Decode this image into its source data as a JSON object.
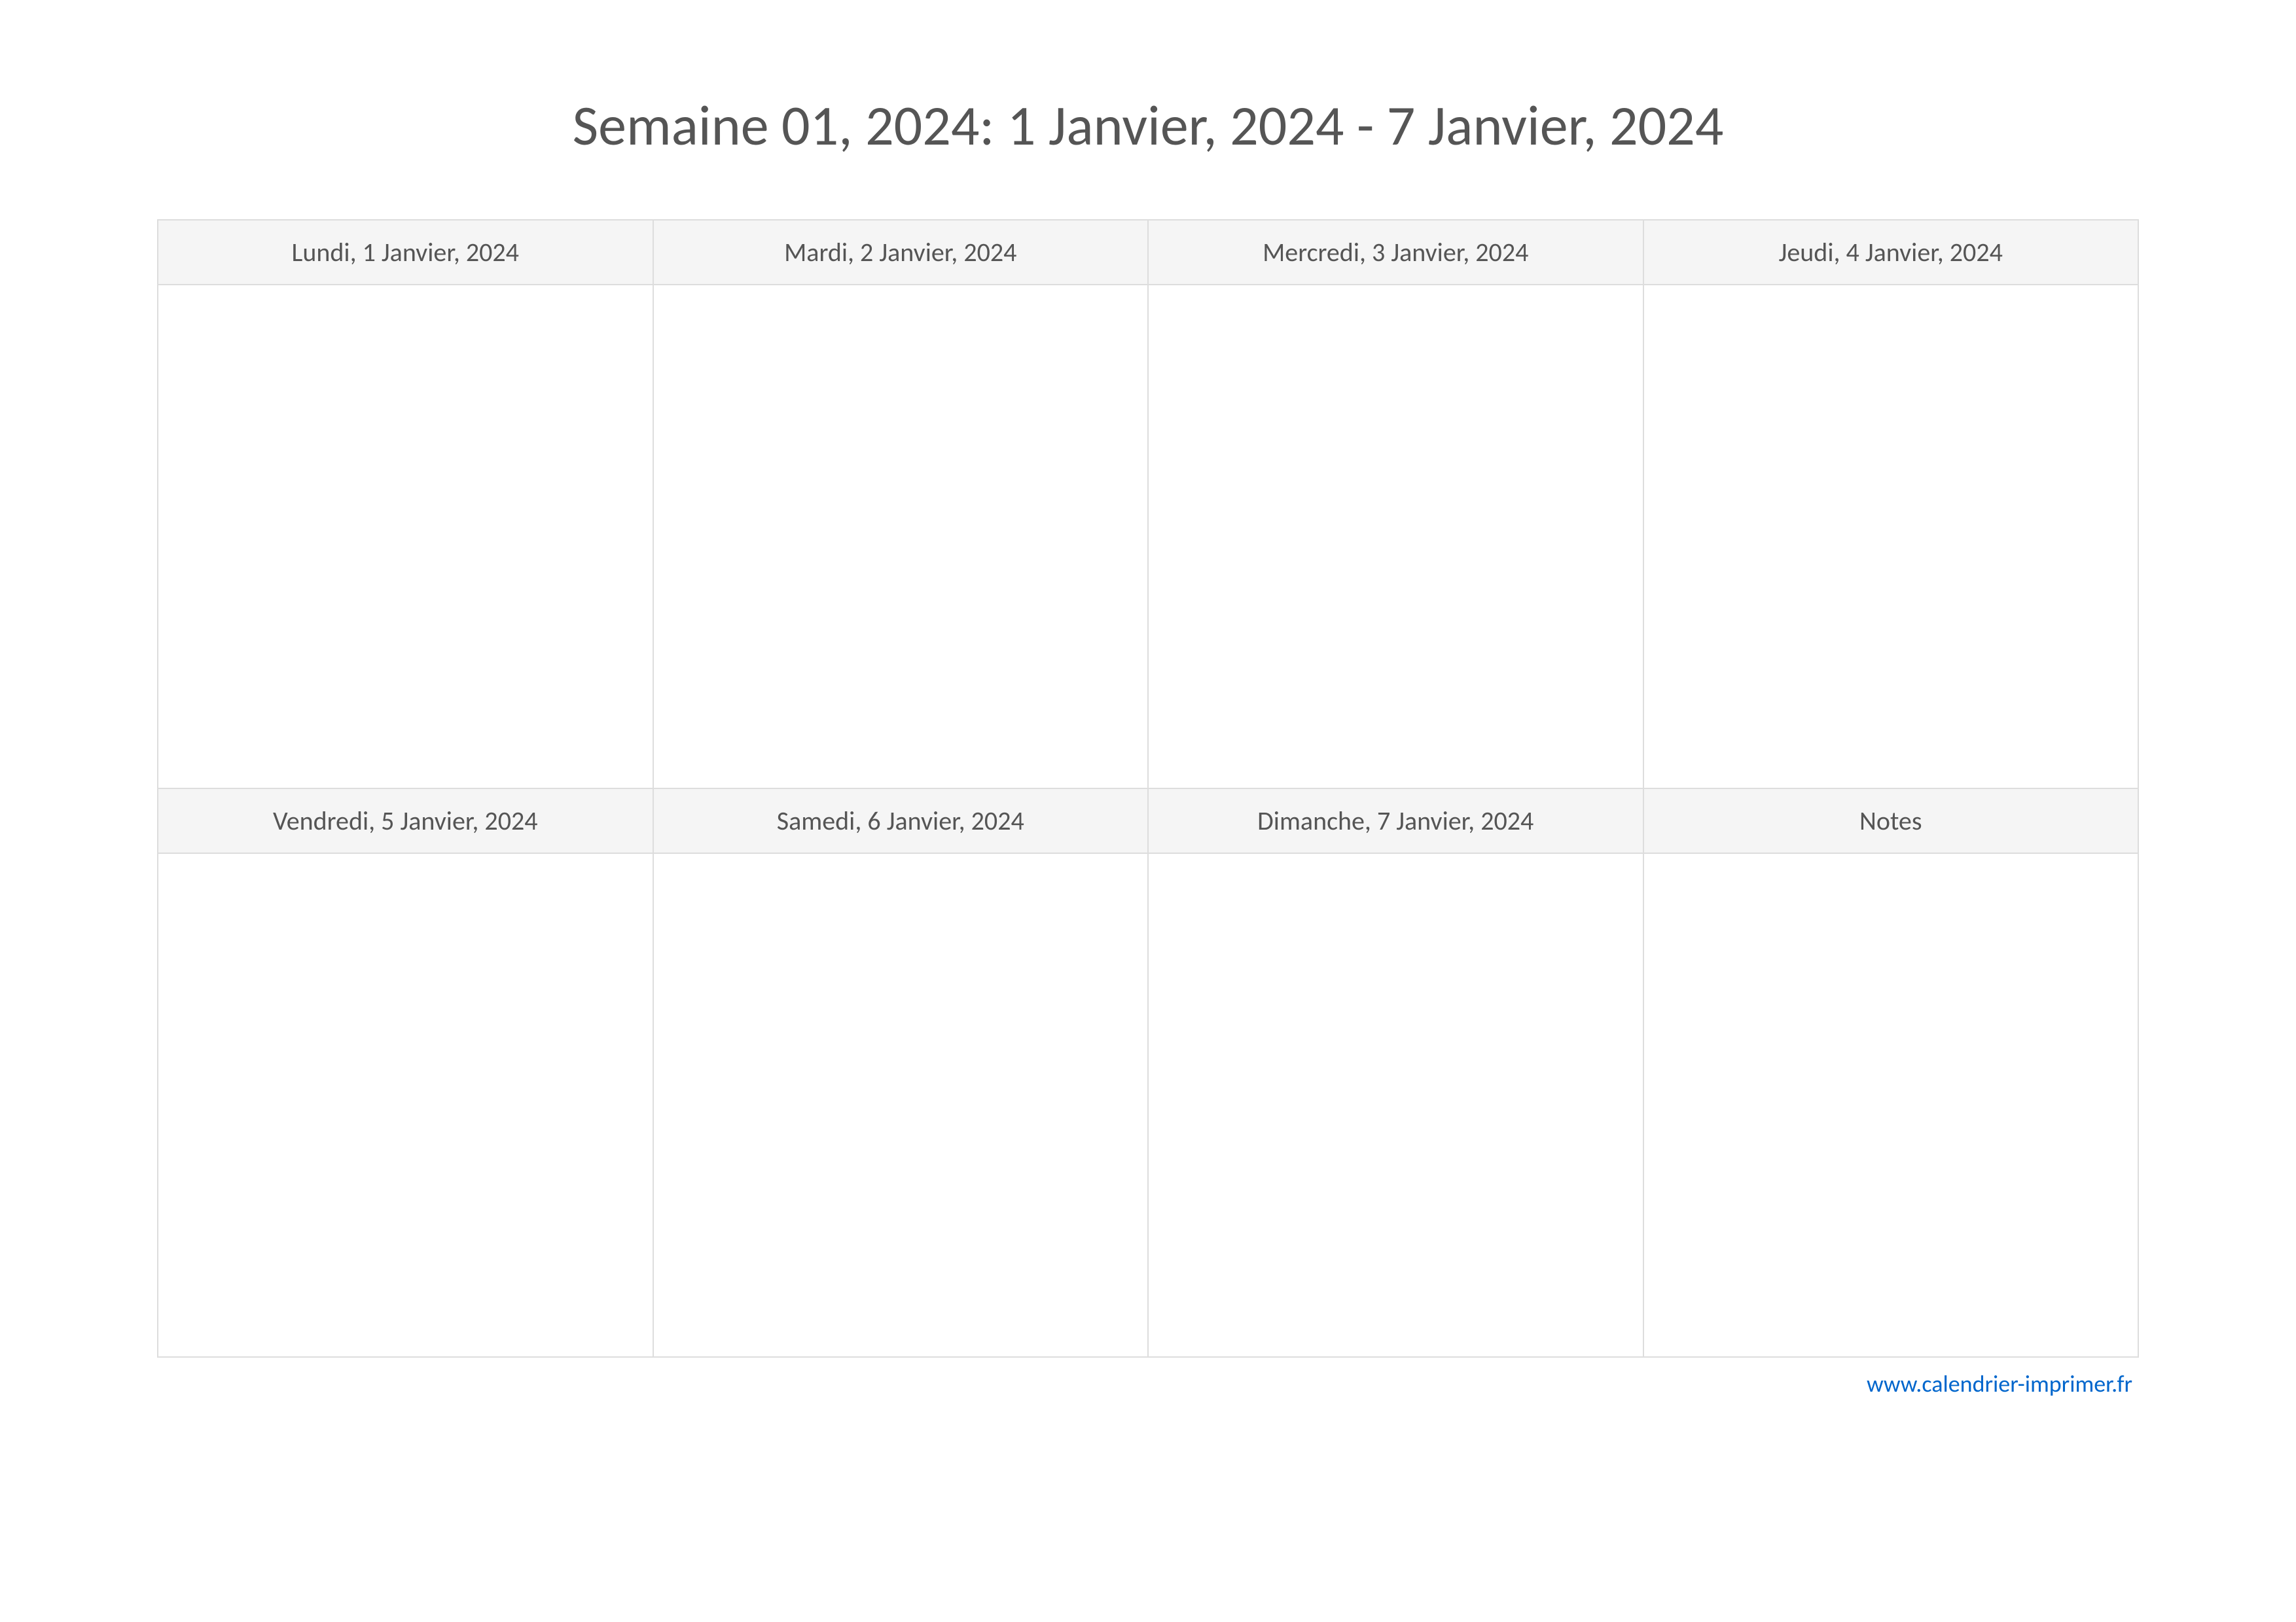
{
  "title": "Semaine 01, 2024: 1 Janvier, 2024 - 7 Janvier, 2024",
  "row1": {
    "headers": [
      "Lundi, 1 Janvier, 2024",
      "Mardi, 2 Janvier, 2024",
      "Mercredi, 3 Janvier, 2024",
      "Jeudi, 4 Janvier, 2024"
    ]
  },
  "row2": {
    "headers": [
      "Vendredi, 5 Janvier, 2024",
      "Samedi, 6 Janvier, 2024",
      "Dimanche, 7 Janvier, 2024",
      "Notes"
    ]
  },
  "footer": {
    "link": "www.calendrier-imprimer.fr"
  }
}
